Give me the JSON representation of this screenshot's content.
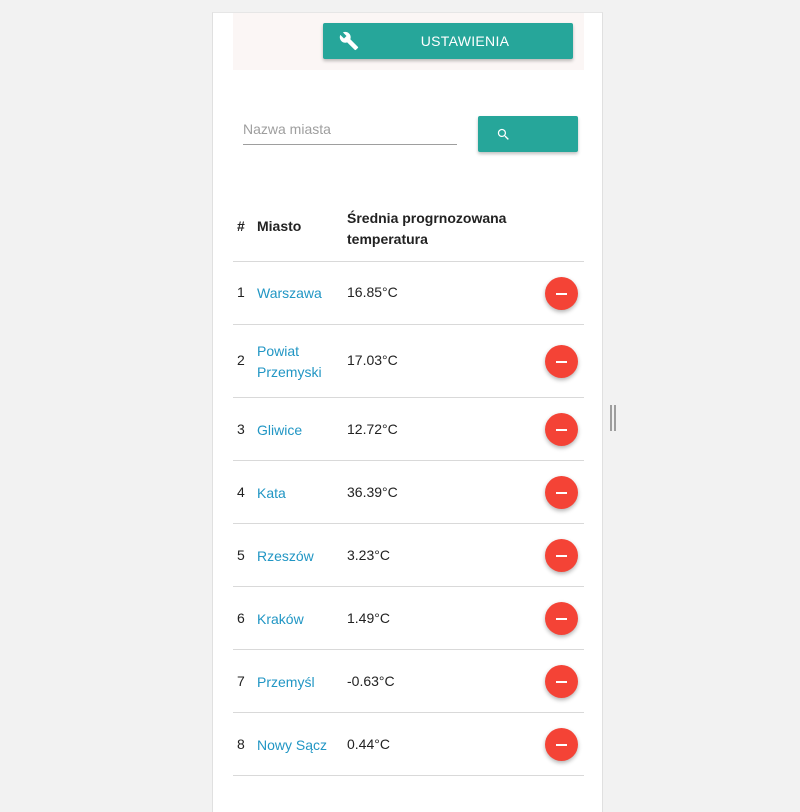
{
  "toolbar": {
    "settings_label": "USTAWIENIA",
    "settings_icon": "wrench-icon"
  },
  "search": {
    "placeholder": "Nazwa miasta",
    "value": "",
    "button_icon": "search-icon"
  },
  "table": {
    "headers": {
      "index": "#",
      "city": "Miasto",
      "temperature": "Średnia progrnozowana temperatura"
    },
    "rows": [
      {
        "index": "1",
        "city": "Warszawa",
        "temperature": "16.85°C"
      },
      {
        "index": "2",
        "city": "Powiat Przemyski",
        "temperature": "17.03°C"
      },
      {
        "index": "3",
        "city": "Gliwice",
        "temperature": "12.72°C"
      },
      {
        "index": "4",
        "city": "Kata",
        "temperature": "36.39°C"
      },
      {
        "index": "5",
        "city": "Rzeszów",
        "temperature": "3.23°C"
      },
      {
        "index": "6",
        "city": "Kraków",
        "temperature": "1.49°C"
      },
      {
        "index": "7",
        "city": "Przemyśl",
        "temperature": "-0.63°C"
      },
      {
        "index": "8",
        "city": "Nowy Sącz",
        "temperature": "0.44°C"
      }
    ],
    "delete_icon": "remove-icon"
  },
  "colors": {
    "accent": "#26a69a",
    "delete": "#f44336",
    "link": "#2196c4",
    "top_strip": "#fbf6f5"
  }
}
